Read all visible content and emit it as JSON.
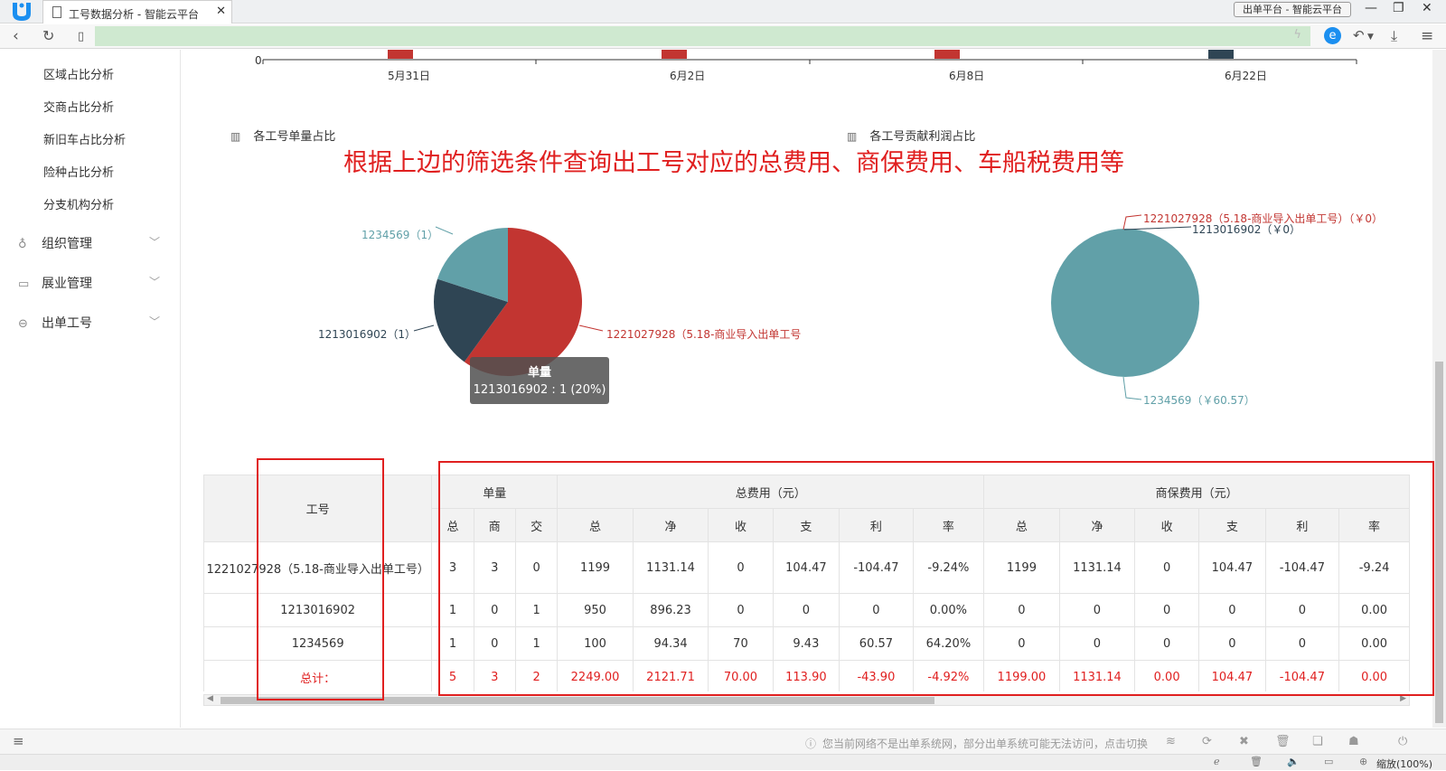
{
  "browser": {
    "tab_title": "工号数据分析 - 智能云平台",
    "window_title": "出单平台 - 智能云平台",
    "accent": "#1b8ff0",
    "address_bar_color": "#cfe9d0"
  },
  "sidebar": {
    "sub_items": [
      "区域占比分析",
      "交商占比分析",
      "新旧车占比分析",
      "险种占比分析",
      "分支机构分析"
    ],
    "groups": [
      {
        "label": "组织管理",
        "icon": "org-icon"
      },
      {
        "label": "展业管理",
        "icon": "briefcase-icon"
      },
      {
        "label": "出单工号",
        "icon": "id-icon"
      }
    ]
  },
  "top_chart": {
    "x_labels": [
      "5月31日",
      "6月2日",
      "6月8日",
      "6月22日"
    ],
    "y_zero": "0",
    "bar_colors": [
      "#c23531",
      "#c23531",
      "#c23531",
      "#2f4554"
    ]
  },
  "annotation": "根据上边的筛选条件查询出工号对应的总费用、商保费用、车船税费用等",
  "chart_data": [
    {
      "type": "pie",
      "title": "各工号单量占比",
      "labels": [
        "1221027928（5.18-商业导入出单工号",
        "1213016902（1）",
        "1234569（1）"
      ],
      "values": [
        3,
        1,
        1
      ],
      "colors": [
        "#c23531",
        "#2f4554",
        "#61a0a8"
      ],
      "tooltip": {
        "title": "单量",
        "text": "1213016902 : 1 (20%)"
      }
    },
    {
      "type": "pie",
      "title": "各工号贡献利润占比",
      "labels": [
        "1221027928（5.18-商业导入出单工号）（￥0）",
        "1213016902（￥0）",
        "1234569（￥60.57）"
      ],
      "values": [
        0,
        0,
        60.57
      ],
      "colors": [
        "#c23531",
        "#2f4554",
        "#61a0a8"
      ]
    }
  ],
  "table": {
    "col_id": "工号",
    "group_headers": [
      "单量",
      "总费用（元）",
      "商保费用（元）"
    ],
    "sub_headers_count": [
      "总",
      "商",
      "交"
    ],
    "sub_headers_fee": [
      "总",
      "净",
      "收",
      "支",
      "利",
      "率"
    ],
    "rows": [
      [
        "1221027928（5.18-商业导入出单工号）",
        "3",
        "3",
        "0",
        "1199",
        "1131.14",
        "0",
        "104.47",
        "-104.47",
        "-9.24%",
        "1199",
        "1131.14",
        "0",
        "104.47",
        "-104.47",
        "-9.24"
      ],
      [
        "1213016902",
        "1",
        "0",
        "1",
        "950",
        "896.23",
        "0",
        "0",
        "0",
        "0.00%",
        "0",
        "0",
        "0",
        "0",
        "0",
        "0.00"
      ],
      [
        "1234569",
        "1",
        "0",
        "1",
        "100",
        "94.34",
        "70",
        "9.43",
        "60.57",
        "64.20%",
        "0",
        "0",
        "0",
        "0",
        "0",
        "0.00"
      ]
    ],
    "total_row": [
      "总计：",
      "5",
      "3",
      "2",
      "2249.00",
      "2121.71",
      "70.00",
      "113.90",
      "-43.90",
      "-4.92%",
      "1199.00",
      "1131.14",
      "0.00",
      "104.47",
      "-104.47",
      "0.00"
    ]
  },
  "footer": {
    "network_notice": "您当前网络不是出单系统网，部分出单系统可能无法访问，点击切换",
    "zoom": "缩放(100%)"
  }
}
